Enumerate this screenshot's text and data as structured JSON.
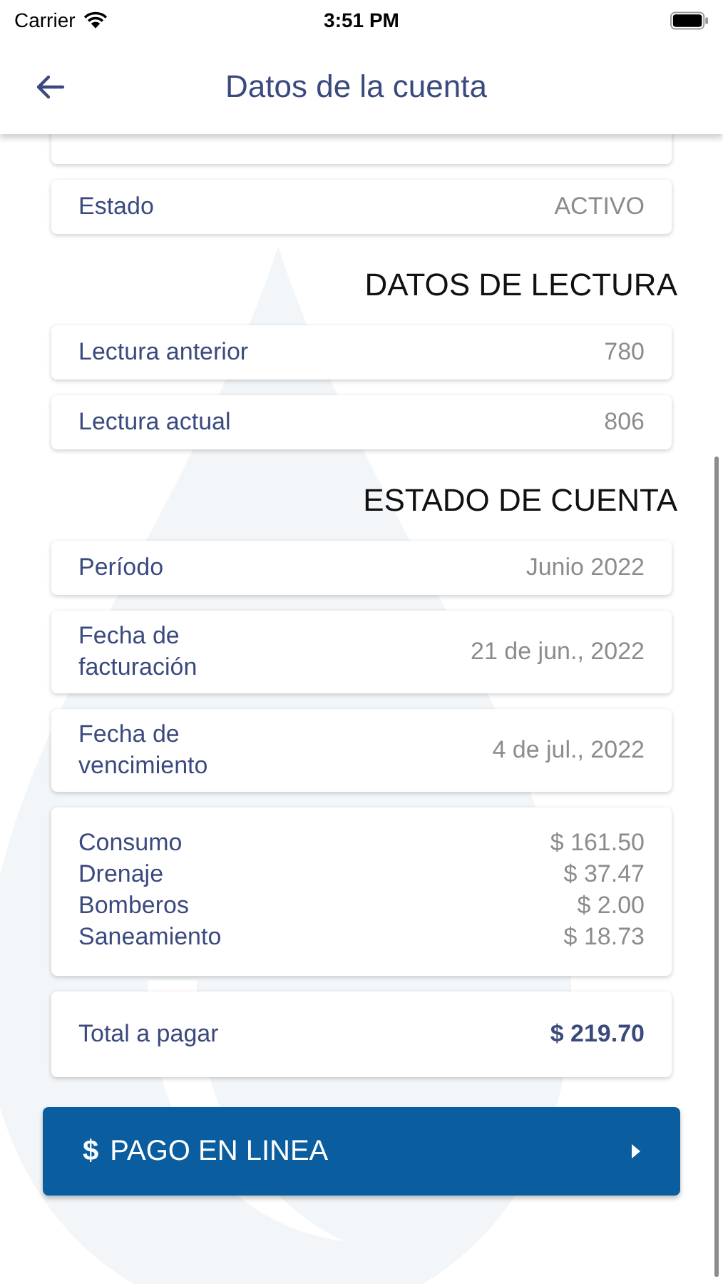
{
  "status_bar": {
    "carrier": "Carrier",
    "time": "3:51 PM"
  },
  "header": {
    "title": "Datos de la cuenta"
  },
  "sections": [
    {
      "rows": [
        {
          "kind": "hidden"
        },
        {
          "kind": "row",
          "label": "Estado",
          "value": "ACTIVO"
        }
      ]
    },
    {
      "heading": "DATOS DE LECTURA",
      "rows": [
        {
          "kind": "row",
          "label": "Lectura anterior",
          "value": "780"
        },
        {
          "kind": "row",
          "label": "Lectura actual",
          "value": "806"
        }
      ]
    },
    {
      "heading": "ESTADO DE CUENTA",
      "rows": [
        {
          "kind": "row",
          "label": "Período",
          "value": "Junio 2022"
        },
        {
          "kind": "row",
          "label": "Fecha de facturación",
          "value": "21 de jun., 2022"
        },
        {
          "kind": "row",
          "label": "Fecha de vencimiento",
          "value": "4 de jul., 2022"
        },
        {
          "kind": "charges",
          "items": [
            {
              "label": "Consumo",
              "value": "$ 161.50"
            },
            {
              "label": "Drenaje",
              "value": "$ 37.47"
            },
            {
              "label": "Bomberos",
              "value": "$ 2.00"
            },
            {
              "label": "Saneamiento",
              "value": "$ 18.73"
            }
          ]
        },
        {
          "kind": "total",
          "label": "Total a pagar",
          "value": "$ 219.70"
        }
      ]
    }
  ],
  "pay_button": {
    "icon": "$",
    "label": "PAGO EN LINEA"
  }
}
